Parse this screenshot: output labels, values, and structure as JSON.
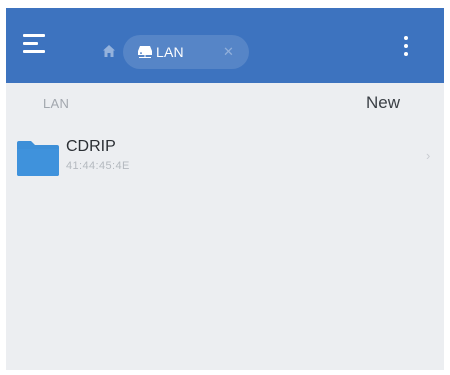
{
  "appbar": {
    "background_color": "#3d73bf",
    "menu_icon": "hamburger-menu-icon",
    "home_icon": "home-icon",
    "location_chip": {
      "icon": "network-drive-icon",
      "label": "LAN",
      "close_icon": "close-icon"
    },
    "overflow_icon": "more-vertical-icon"
  },
  "section": {
    "title": "LAN",
    "new_label": "New"
  },
  "items": [
    {
      "name": "CDRIP",
      "subtitle": "41:44:45:4E",
      "icon": "folder-icon",
      "icon_color": "#3d8fd8",
      "trailing_icon": "chevron-right-icon"
    }
  ]
}
